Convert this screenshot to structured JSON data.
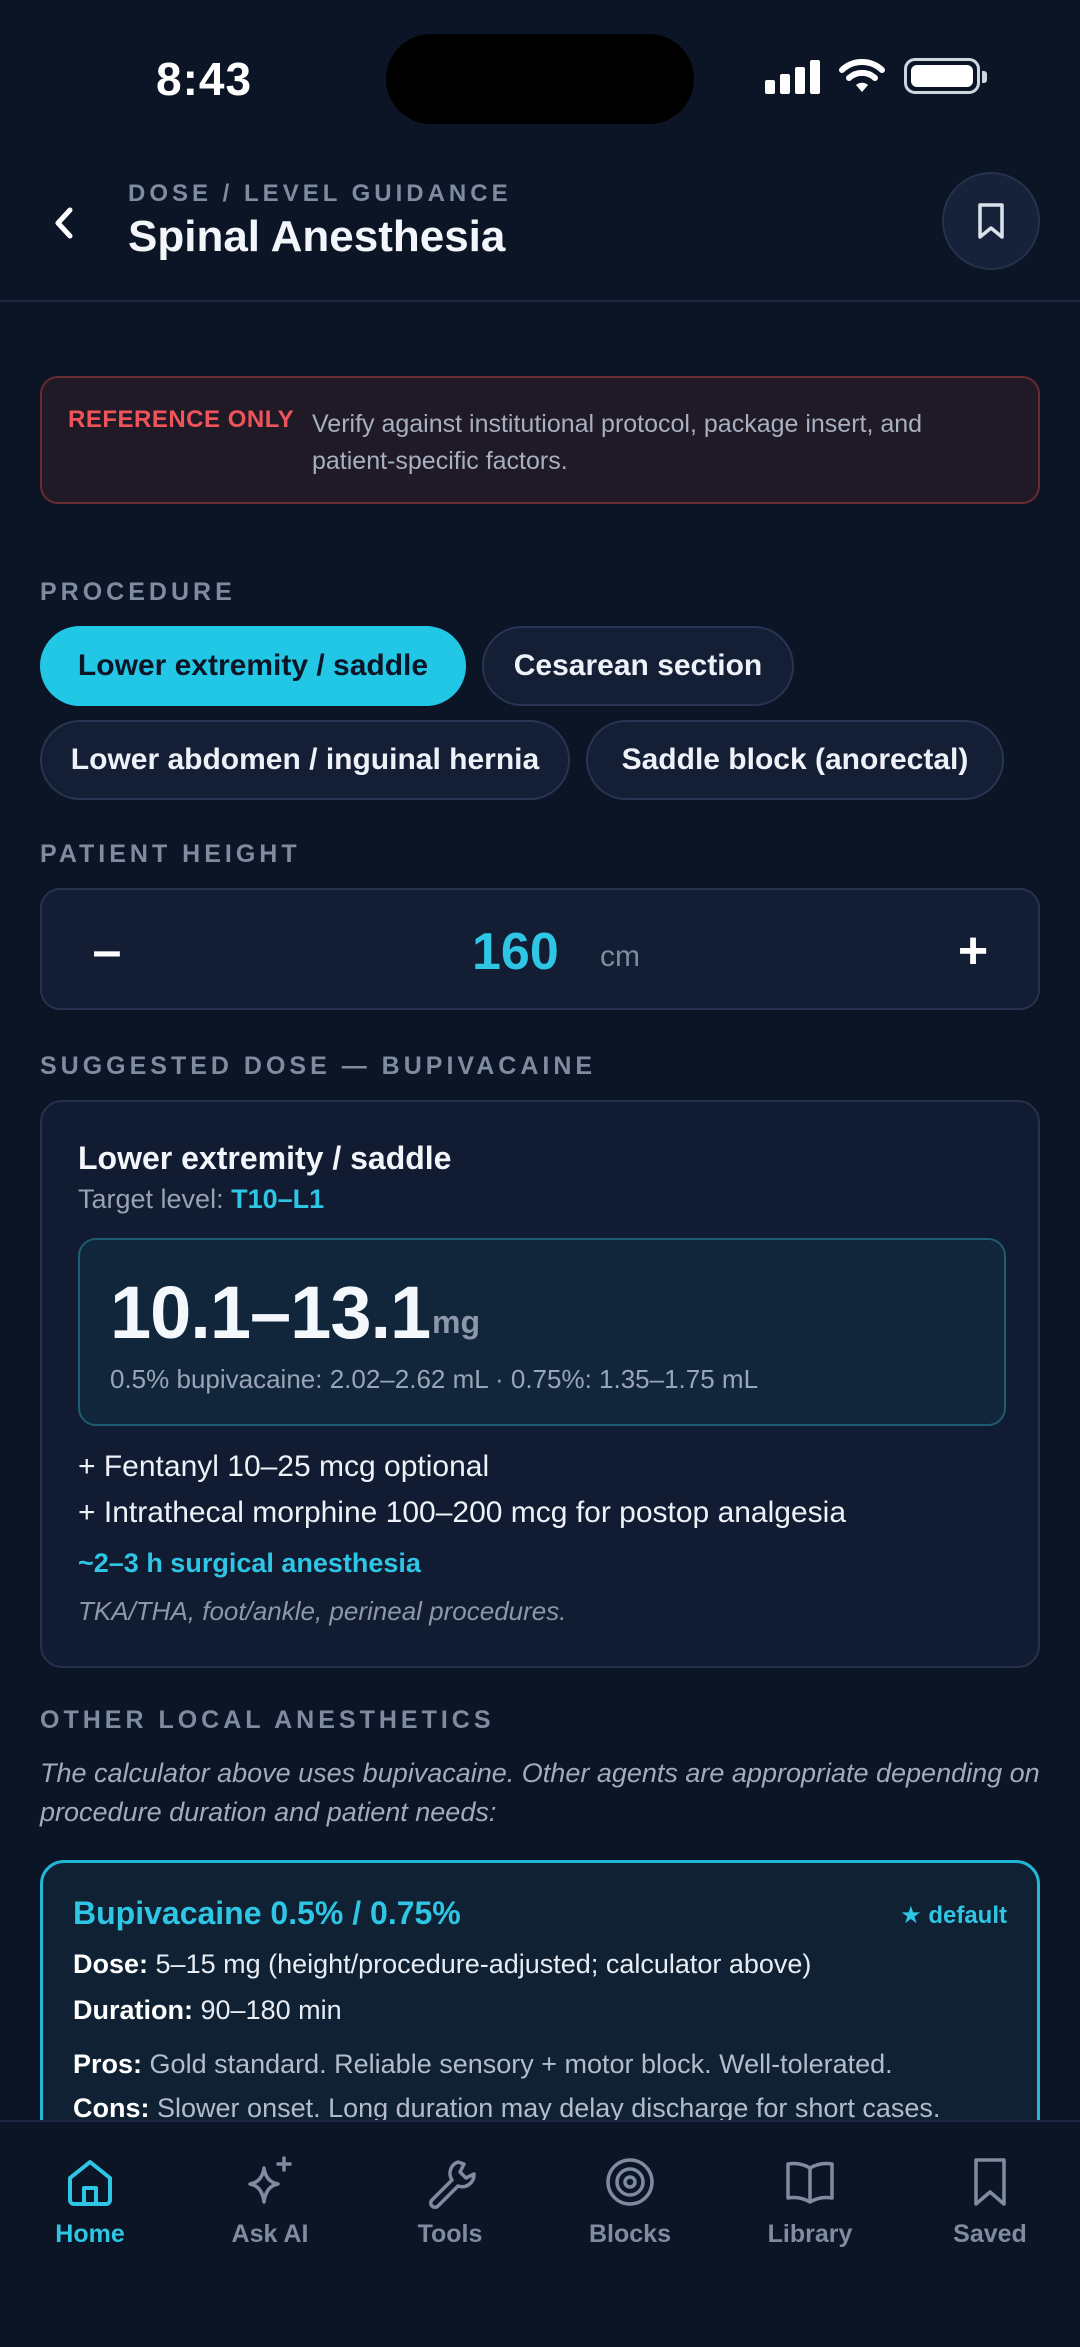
{
  "status_bar": {
    "time": "8:43"
  },
  "header": {
    "eyebrow": "DOSE / LEVEL GUIDANCE",
    "title": "Spinal Anesthesia"
  },
  "warning": {
    "label": "REFERENCE ONLY",
    "text": "Verify against institutional protocol, package insert, and patient-specific factors."
  },
  "procedure": {
    "label": "PROCEDURE",
    "options": [
      {
        "label": "Lower extremity / saddle",
        "selected": true
      },
      {
        "label": "Cesarean section",
        "selected": false
      },
      {
        "label": "Lower abdomen / inguinal hernia",
        "selected": false
      },
      {
        "label": "Saddle block (anorectal)",
        "selected": false
      }
    ]
  },
  "height": {
    "label": "PATIENT HEIGHT",
    "minus": "–",
    "value": "160",
    "unit": "cm",
    "plus": "+"
  },
  "dose": {
    "label": "SUGGESTED DOSE — BUPIVACAINE",
    "title": "Lower extremity / saddle",
    "target_prefix": "Target level:",
    "target_level": "T10–L1",
    "range": "10.1–13.1",
    "unit": "mg",
    "conversion": "0.5% bupivacaine: 2.02–2.62 mL · 0.75%: 1.35–1.75 mL",
    "adjuncts": [
      "+ Fentanyl 10–25 mcg optional",
      "+ Intrathecal morphine 100–200 mcg for postop analgesia"
    ],
    "duration": "~2–3 h surgical anesthesia",
    "note": "TKA/THA, foot/ankle, perineal procedures."
  },
  "other": {
    "label": "OTHER LOCAL ANESTHETICS",
    "description": "The calculator above uses bupivacaine. Other agents are appropriate depending on procedure duration and patient needs:",
    "agents": [
      {
        "name": "Bupivacaine 0.5% / 0.75%",
        "badge": "★ default",
        "dose_label": "Dose:",
        "dose": "5–15 mg (height/procedure-adjusted; calculator above)",
        "duration_label": "Duration:",
        "duration": "90–180 min",
        "pros_label": "Pros:",
        "pros": "Gold standard. Reliable sensory + motor block. Well-tolerated.",
        "cons_label": "Cons:",
        "cons": "Slower onset. Long duration may delay discharge for short cases."
      }
    ]
  },
  "tabbar": {
    "tabs": [
      {
        "label": "Home",
        "icon": "home-icon",
        "active": true
      },
      {
        "label": "Ask AI",
        "icon": "sparkles-icon",
        "active": false
      },
      {
        "label": "Tools",
        "icon": "wrench-icon",
        "active": false
      },
      {
        "label": "Blocks",
        "icon": "target-icon",
        "active": false
      },
      {
        "label": "Library",
        "icon": "book-icon",
        "active": false
      },
      {
        "label": "Saved",
        "icon": "bookmark-icon",
        "active": false
      }
    ]
  },
  "colors": {
    "accent": "#23c7e6",
    "background": "#0c1526",
    "warning": "#f0545b"
  }
}
